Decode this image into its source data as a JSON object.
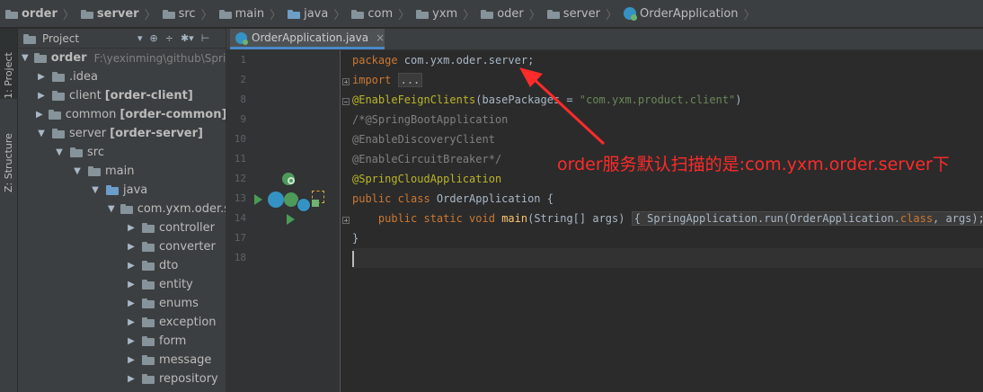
{
  "breadcrumbs": [
    "order",
    "server",
    "src",
    "main",
    "java",
    "com",
    "yxm",
    "oder",
    "server",
    "OrderApplication"
  ],
  "left_strip": {
    "project_tab": "1: Project",
    "structure_tab": "Z: Structure"
  },
  "project_panel": {
    "title": "Project",
    "toolbar": {
      "dropdown": "▾",
      "target": "⊕",
      "collapse": "÷",
      "gear": "✱▾",
      "hide": "⊢"
    },
    "tree": [
      {
        "label": "order",
        "path": "F:\\yexinming\\github\\SpringCloud",
        "suffix": ""
      },
      {
        "label": ".idea",
        "suffix": ""
      },
      {
        "label": "client",
        "suffix": "[order-client]"
      },
      {
        "label": "common",
        "suffix": "[order-common]"
      },
      {
        "label": "server",
        "suffix": "[order-server]"
      },
      {
        "label": "src",
        "suffix": ""
      },
      {
        "label": "main",
        "suffix": ""
      },
      {
        "label": "java",
        "suffix": ""
      },
      {
        "label": "com.yxm.oder.server",
        "suffix": ""
      },
      {
        "label": "controller",
        "suffix": ""
      },
      {
        "label": "converter",
        "suffix": ""
      },
      {
        "label": "dto",
        "suffix": ""
      },
      {
        "label": "entity",
        "suffix": ""
      },
      {
        "label": "enums",
        "suffix": ""
      },
      {
        "label": "exception",
        "suffix": ""
      },
      {
        "label": "form",
        "suffix": ""
      },
      {
        "label": "message",
        "suffix": ""
      },
      {
        "label": "repository",
        "suffix": ""
      }
    ]
  },
  "editor": {
    "tab_name": "OrderApplication.java",
    "tab_close": "×",
    "line_numbers": [
      "1",
      "2",
      "8",
      "9",
      "10",
      "11",
      "12",
      "13",
      "14",
      "17",
      "18"
    ],
    "code": {
      "l1_kw": "package",
      "l1_rest": " com.yxm.oder.server;",
      "l2_kw": "import",
      "l2_fold": "...",
      "l8_ann": "@EnableFeignClients",
      "l8_open": "(basePackages = ",
      "l8_str": "\"com.yxm.product.client\"",
      "l8_close": ")",
      "l9": "/*@SpringBootApplication",
      "l10": "@EnableDiscoveryClient",
      "l11": "@EnableCircuitBreaker*/",
      "l12": "@SpringCloudApplication",
      "l13_kw": "public class",
      "l13_rest": " OrderApplication {",
      "l14_kw": "public static void",
      "l14_name": "main",
      "l14_args": "(String[] args)",
      "l14_fold": "{ SpringApplication.run(OrderApplication.",
      "l14_kw2": "class",
      "l14_fold_end": ", args); }",
      "l17": "}"
    }
  },
  "annotation_note": "order服务默认扫描的是:com.yxm.order.server下",
  "colors": {
    "note": "#ff2a2a",
    "keyword": "#cc7832",
    "annotation": "#bbb529",
    "string": "#6a8759"
  }
}
